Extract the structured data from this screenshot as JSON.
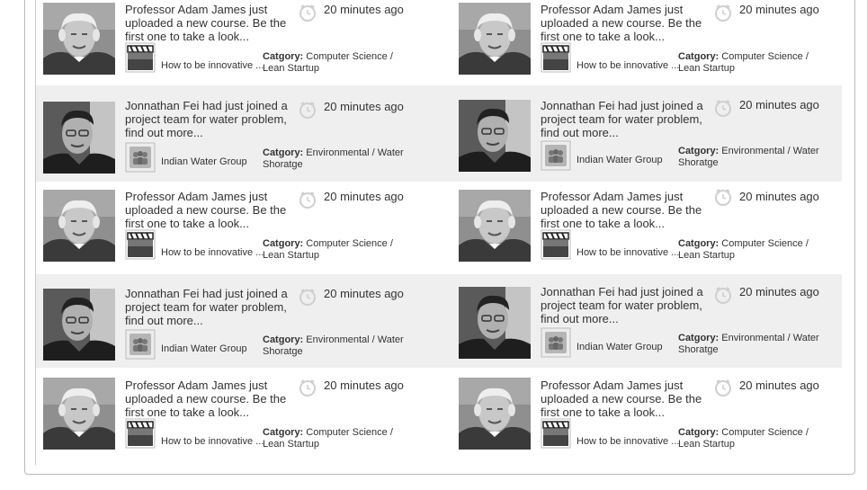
{
  "posts": {
    "adam": {
      "message": "Professor Adam James just uploaded a new course.  Be the first one to take a look...",
      "time": "20 minutes ago",
      "attachment": "How to be innovative ...",
      "category_label": "Catgory:",
      "category_value": "Computer Science / Lean Startup",
      "avatar_icon": "man-gray-hair-avatar",
      "attachment_icon": "clapperboard-icon"
    },
    "jon": {
      "message": "Jonnathan Fei had just joined a project team for water problem, find out more...",
      "time": "20 minutes ago",
      "attachment": "Indian Water Group",
      "category_label": "Catgory:",
      "category_value": "Environmental / Water Shoratge",
      "avatar_icon": "young-man-avatar",
      "attachment_icon": "group-icon"
    }
  }
}
